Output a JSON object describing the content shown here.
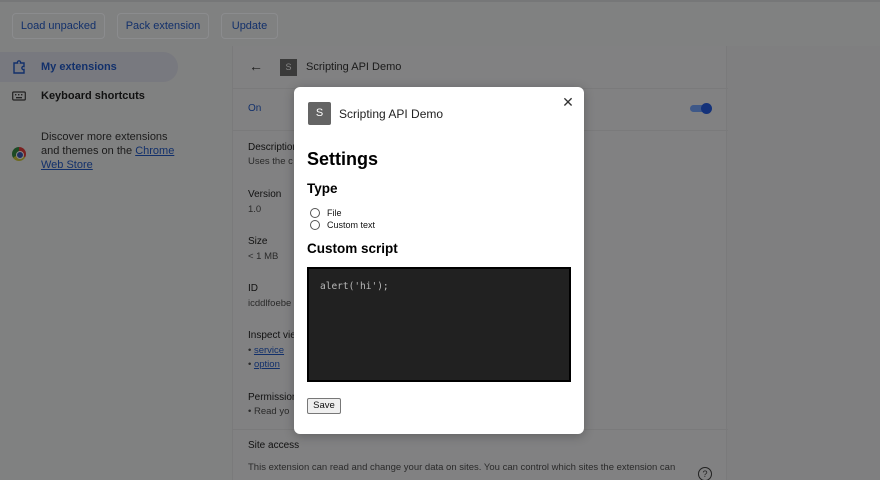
{
  "toolbar": {
    "load_unpacked": "Load unpacked",
    "pack_extension": "Pack extension",
    "update": "Update"
  },
  "sidebar": {
    "items": [
      {
        "label": "My extensions",
        "icon": "puzzle-icon",
        "active": true
      },
      {
        "label": "Keyboard shortcuts",
        "icon": "keyboard-icon",
        "active": false
      }
    ],
    "discover_text": "Discover more extensions and themes on the ",
    "discover_link": "Chrome Web Store"
  },
  "details": {
    "name": "Scripting API Demo",
    "badge": "S",
    "on_label": "On",
    "enabled": true,
    "description_label": "Description",
    "description_value": "Uses the c",
    "version_label": "Version",
    "version_value": "1.0",
    "size_label": "Size",
    "size_value": "< 1 MB",
    "id_label": "ID",
    "id_value": "icddlfoebe",
    "inspect_label": "Inspect vie",
    "inspect_links": [
      "service",
      "option"
    ],
    "permissions_label": "Permission",
    "permissions_value": "Read yo",
    "site_access_label": "Site access",
    "site_access_text": "This extension can read and change your data on sites. You can control which sites the extension can"
  },
  "modal": {
    "avatar": "S",
    "title": "Scripting API Demo",
    "close_icon": "close-icon",
    "heading": "Settings",
    "type_heading": "Type",
    "type_options": [
      "File",
      "Custom text"
    ],
    "script_heading": "Custom script",
    "script_value": "alert('hi');",
    "save_label": "Save"
  },
  "colors": {
    "accent": "#1a73e8",
    "overlay": "#7f7f80",
    "editor_bg": "#212121"
  }
}
